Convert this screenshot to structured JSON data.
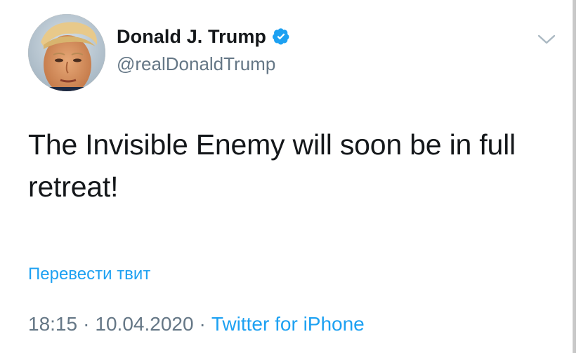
{
  "author": {
    "display_name": "Donald J. Trump",
    "handle": "@realDonaldTrump",
    "verified": true,
    "avatar_icon": "profile-photo"
  },
  "tweet": {
    "text": "The Invisible Enemy will soon be in full retreat!",
    "translate_label": "Перевести твит",
    "time": "18:15",
    "separator": "·",
    "date": "10.04.2020",
    "source": "Twitter for iPhone"
  },
  "icons": {
    "verified": "verified-badge-icon",
    "menu": "chevron-down-icon"
  },
  "colors": {
    "accent": "#1da1f2",
    "text": "#14171a",
    "secondary": "#657786"
  }
}
